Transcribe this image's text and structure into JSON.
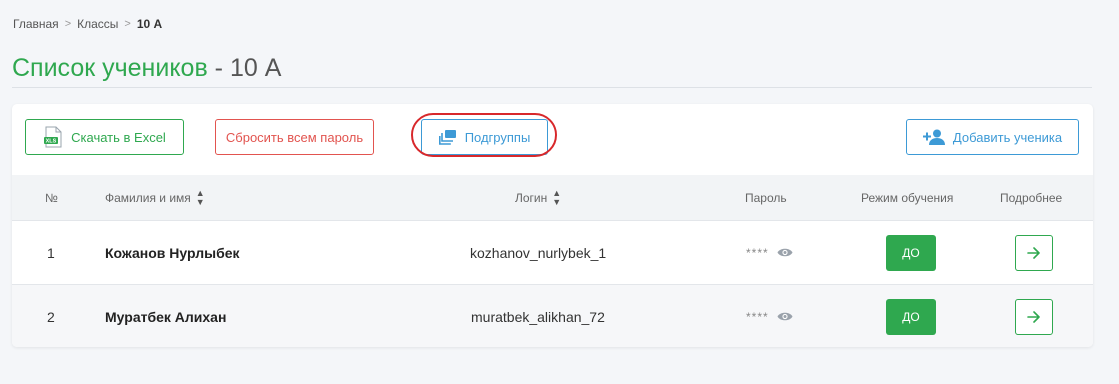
{
  "breadcrumb": {
    "items": [
      "Главная",
      "Классы",
      "10 А"
    ]
  },
  "page": {
    "title_main": "Список учеников",
    "title_sub": " - 10 А"
  },
  "toolbar": {
    "excel_label": "Скачать в Excel",
    "reset_label": "Сбросить всем пароль",
    "subgroups_label": "Подгруппы",
    "add_label": "Добавить ученика"
  },
  "table": {
    "headers": {
      "num": "№",
      "name": "Фамилия и имя",
      "login": "Логин",
      "password": "Пароль",
      "mode": "Режим обучения",
      "details": "Подробнее"
    },
    "rows": [
      {
        "num": "1",
        "name": "Кожанов Нурлыбек",
        "login": "kozhanov_nurlybek_1",
        "password": "****",
        "mode": "ДО"
      },
      {
        "num": "2",
        "name": "Муратбек Алихан",
        "login": "muratbek_alikhan_72",
        "password": "****",
        "mode": "ДО"
      }
    ]
  },
  "colors": {
    "green": "#2fa84f",
    "red": "#e2544f",
    "blue": "#3d9ad6",
    "highlight": "#d8282b"
  },
  "icons": {
    "excel": "xls-file-icon",
    "subgroups": "layers-icon",
    "add": "add-user-icon",
    "sort": "sort-icon",
    "eye": "eye-icon",
    "details": "arrow-right-icon"
  }
}
